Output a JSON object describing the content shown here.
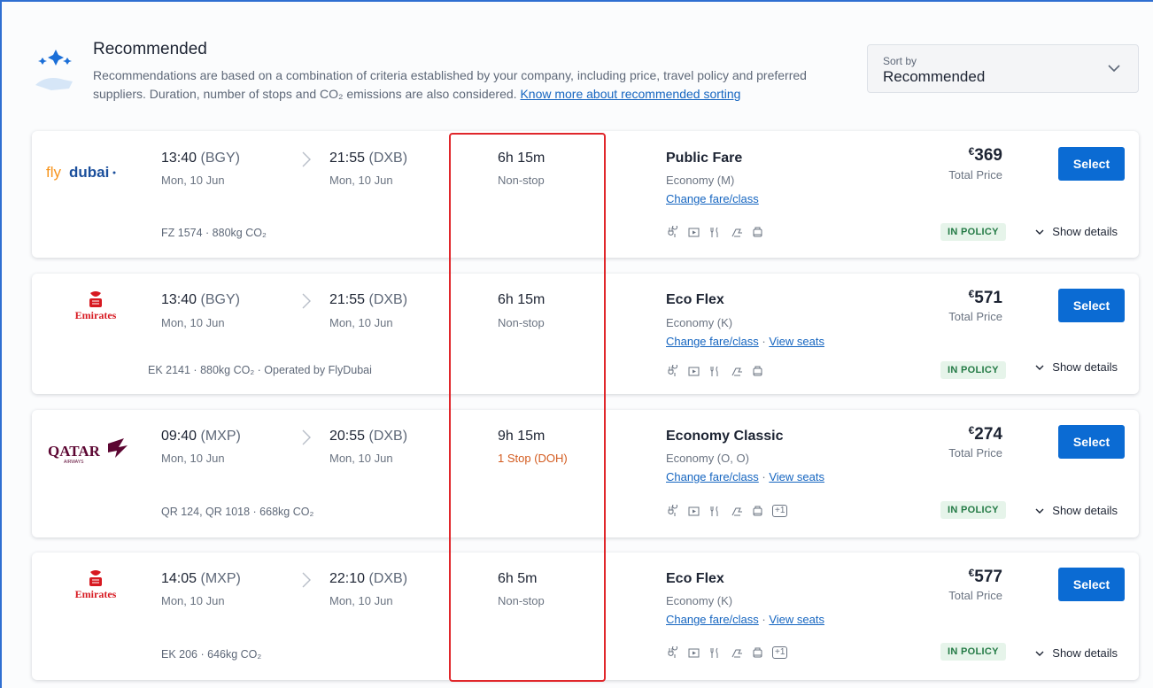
{
  "header": {
    "title": "Recommended",
    "description": "Recommendations are based on a combination of criteria established by your company, including price, travel policy and preferred suppliers. Duration, number of stops and CO₂ emissions are also considered.",
    "link_text": "Know more about recommended sorting",
    "icon": "sparkle-hand-icon"
  },
  "sort": {
    "label": "Sort by",
    "value": "Recommended"
  },
  "flights": [
    {
      "airline": "flydubai",
      "dep_time": "13:40",
      "dep_code": "(BGY)",
      "dep_date": "Mon, 10 Jun",
      "arr_time": "21:55",
      "arr_code": "(DXB)",
      "arr_date": "Mon, 10 Jun",
      "info": "FZ 1574 · 880kg CO₂",
      "duration": "6h 15m",
      "stops": "Non-stop",
      "fare": "Public Fare",
      "fare_class": "Economy (M)",
      "change_link": "Change fare/class",
      "seats_link": "",
      "extra_amenities": "",
      "currency": "€",
      "price": "369",
      "price_label": "Total Price",
      "select": "Select",
      "policy": "IN POLICY",
      "details": "Show details"
    },
    {
      "airline": "Emirates",
      "dep_time": "13:40",
      "dep_code": "(BGY)",
      "dep_date": "Mon, 10 Jun",
      "arr_time": "21:55",
      "arr_code": "(DXB)",
      "arr_date": "Mon, 10 Jun",
      "info": "EK 2141 · 880kg CO₂ · Operated by FlyDubai",
      "duration": "6h 15m",
      "stops": "Non-stop",
      "fare": "Eco Flex",
      "fare_class": "Economy (K)",
      "change_link": "Change fare/class",
      "seats_link": "View seats",
      "extra_amenities": "",
      "currency": "€",
      "price": "571",
      "price_label": "Total Price",
      "select": "Select",
      "policy": "IN POLICY",
      "details": "Show details"
    },
    {
      "airline": "QATAR",
      "dep_time": "09:40",
      "dep_code": "(MXP)",
      "dep_date": "Mon, 10 Jun",
      "arr_time": "20:55",
      "arr_code": "(DXB)",
      "arr_date": "Mon, 10 Jun",
      "info": "QR 124, QR 1018 · 668kg CO₂",
      "duration": "9h 15m",
      "stops": "1 Stop (DOH)",
      "fare": "Economy Classic",
      "fare_class": "Economy (O, O)",
      "change_link": "Change fare/class",
      "seats_link": "View seats",
      "extra_amenities": "+1",
      "currency": "€",
      "price": "274",
      "price_label": "Total Price",
      "select": "Select",
      "policy": "IN POLICY",
      "details": "Show details"
    },
    {
      "airline": "Emirates",
      "dep_time": "14:05",
      "dep_code": "(MXP)",
      "dep_date": "Mon, 10 Jun",
      "arr_time": "22:10",
      "arr_code": "(DXB)",
      "arr_date": "Mon, 10 Jun",
      "info": "EK 206 · 646kg CO₂",
      "duration": "6h 5m",
      "stops": "Non-stop",
      "fare": "Eco Flex",
      "fare_class": "Economy (K)",
      "change_link": "Change fare/class",
      "seats_link": "View seats",
      "extra_amenities": "+1",
      "currency": "€",
      "price": "577",
      "price_label": "Total Price",
      "select": "Select",
      "policy": "IN POLICY",
      "details": "Show details"
    }
  ],
  "colors": {
    "accent": "#0b6bd3",
    "policy_bg": "#e6f4ea",
    "policy_text": "#237a45",
    "stop_warning": "#d35b1f",
    "highlight": "#e0272b",
    "flydubai_orange": "#f7941d",
    "flydubai_blue": "#1b4f9c",
    "emirates_red": "#d71921",
    "qatar_maroon": "#5c0632"
  }
}
